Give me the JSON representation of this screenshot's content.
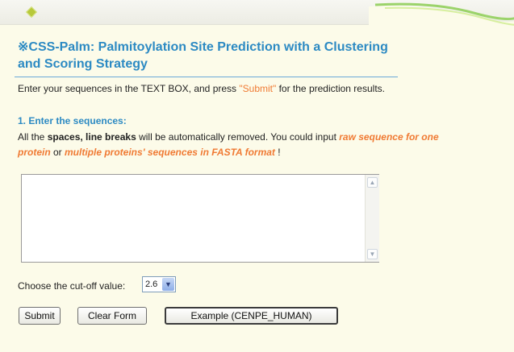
{
  "title": {
    "symbol": "※",
    "part1": "CSS-Palm",
    "part2": ": ",
    "part3": "Palm",
    "part4": "itoylation Site Prediction with a ",
    "part5": "C",
    "part6": "lustering",
    "part7": "and ",
    "part8": "S",
    "part9": "coring ",
    "part10": "S",
    "part11": "trategy"
  },
  "intro": {
    "before": "Enter your sequences in the TEXT BOX, and press ",
    "submit_word": "\"Submit\"",
    "after": " for the prediction results."
  },
  "section": {
    "title": "1. Enter the sequences:",
    "desc_a": "All the ",
    "desc_bold": "spaces, line breaks",
    "desc_b": "  will be automatically removed. You could input ",
    "desc_orange1": "raw sequence for one protein",
    "desc_c": " or ",
    "desc_orange2": "multiple proteins' sequences in FASTA format",
    "desc_d": " !"
  },
  "sequence_input": {
    "value": "",
    "placeholder": ""
  },
  "cutoff": {
    "label": "Choose the cut-off value:",
    "value": "2.6"
  },
  "buttons": {
    "submit": "Submit",
    "clear": "Clear Form",
    "example": "Example (CENPE_HUMAN)"
  },
  "colors": {
    "title_blue": "#2c8ac3",
    "accent_orange": "#f07a33",
    "background": "#fcfbe9"
  }
}
